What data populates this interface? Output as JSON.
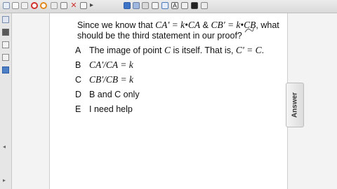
{
  "question": {
    "intro": "Since we know that ",
    "eq1": "CA' = k•CA",
    "amp": " & ",
    "eq2": "CB' = k•CB",
    "tail": ", what should be the third statement in our proof?"
  },
  "choices": [
    {
      "letter": "A",
      "text_plain": "The image of point ",
      "math1": "C",
      "text_mid": " is itself. That is, ",
      "math2": "C' = C",
      "text_end": "."
    },
    {
      "letter": "B",
      "math": "CA'/CA = k"
    },
    {
      "letter": "C",
      "math": "CB'/CB = k"
    },
    {
      "letter": "D",
      "text": "B and C only"
    },
    {
      "letter": "E",
      "text": "I need help"
    }
  ],
  "answer_tab": {
    "label": "Answer"
  },
  "colors": {
    "accent_tab": "#dcdcdc",
    "page": "#ffffff",
    "workspace": "#f3f3f3"
  }
}
